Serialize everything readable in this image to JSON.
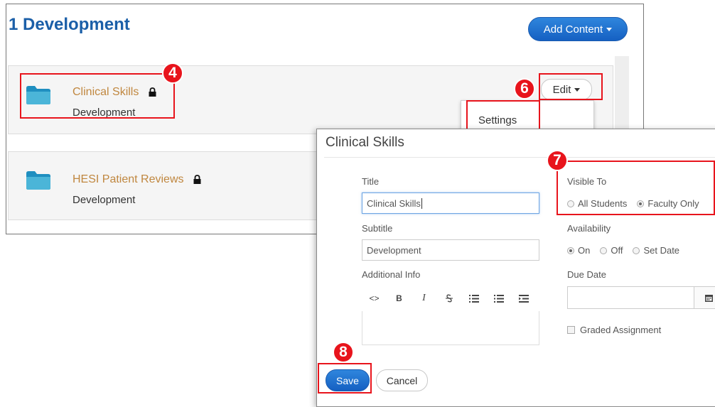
{
  "page": {
    "title": "1 Development",
    "add_content_label": "Add Content"
  },
  "items": [
    {
      "title": "Clinical Skills",
      "subtitle": "Development",
      "locked": true
    },
    {
      "title": "HESI Patient Reviews",
      "subtitle": "Development",
      "locked": true
    }
  ],
  "edit_menu": {
    "edit_label": "Edit",
    "settings_label": "Settings"
  },
  "dialog": {
    "title": "Clinical Skills",
    "title_label": "Title",
    "title_value": "Clinical Skills",
    "subtitle_label": "Subtitle",
    "subtitle_value": "Development",
    "additional_info_label": "Additional Info",
    "toolbar": [
      "<>",
      "B",
      "I",
      "S",
      "ul",
      "ol",
      "indent"
    ],
    "visible_to_label": "Visible To",
    "visible_to_options": [
      "All Students",
      "Faculty Only"
    ],
    "visible_to_selected": "Faculty Only",
    "availability_label": "Availability",
    "availability_options": [
      "On",
      "Off",
      "Set Date"
    ],
    "availability_selected": "On",
    "due_date_label": "Due Date",
    "due_date_value": "",
    "graded_label": "Graded Assignment",
    "graded_checked": false,
    "save_label": "Save",
    "cancel_label": "Cancel"
  },
  "annotations": {
    "marker_items": "4",
    "marker_edit": "6",
    "marker_visible": "7",
    "marker_save": "8"
  },
  "colors": {
    "accent_blue": "#1560c2",
    "title_blue": "#1b5fa8",
    "link_gold": "#c0873f",
    "folder_teal": "#4bb5d8",
    "highlight_red": "#e8141c"
  }
}
